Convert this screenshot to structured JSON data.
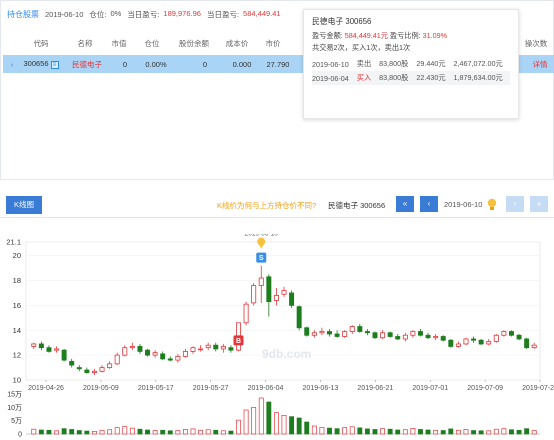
{
  "summary": {
    "title": "持仓股票",
    "date": "2019-06-10",
    "position_label": "仓位:",
    "position_value": "0%",
    "day_pl_label": "当日盈亏:",
    "day_pl_value": "189,976.96",
    "total_pl_label": "当日盈亏:",
    "total_pl_value": "584,449.41"
  },
  "table": {
    "headers": [
      "代码",
      "名称",
      "市值",
      "仓位",
      "股份余额",
      "成本价",
      "市价",
      "操次数"
    ],
    "row": {
      "code": "300656",
      "tag": "",
      "name": "民德电子",
      "market_value": "0",
      "position": "0.00%",
      "shares": "0",
      "cost": "0.000",
      "price": "27.790",
      "detail": "详情"
    }
  },
  "popup": {
    "title": "民德电子 300656",
    "pl_label": "盈亏金额:",
    "pl_value": "584,449.41元",
    "ratio_label": "盈亏比例:",
    "ratio_value": "31.09%",
    "summary": "共交易2次，买入1次，卖出1次",
    "trades": [
      {
        "date": "2019-06-10",
        "type": "卖出",
        "shares": "83,800股",
        "price": "29.440元",
        "amount": "2,467,072.00元"
      },
      {
        "date": "2019-06-04",
        "type": "买入",
        "shares": "83,800股",
        "price": "22.430元",
        "amount": "1,879,634.00元"
      }
    ]
  },
  "kline": {
    "tab_label": "K线图",
    "question": "K线价为何与上方持仓价不同?",
    "stock_label": "民德电子 300656",
    "date": "2019-06-10",
    "nav": [
      "«",
      "‹",
      "›",
      "»"
    ],
    "icon_bulb": "bulb-icon"
  },
  "chart_data": {
    "type": "candlestick",
    "y_ticks": [
      "21.1",
      "20",
      "18",
      "16",
      "14",
      "12",
      "10"
    ],
    "ylim": [
      10,
      21.1
    ],
    "x_labels": [
      "2019-04-26",
      "2019-05-09",
      "2019-05-17",
      "2019-05-27",
      "2019-06-04",
      "2019-06-13",
      "2019-06-21",
      "2019-07-01",
      "2019-07-09",
      "2019-07-23"
    ],
    "vol_ticks": [
      "15万",
      "10万",
      "5万",
      "0"
    ],
    "vol_max": 150000,
    "top_date_label": "2019-06-10",
    "markers": [
      {
        "label": "B",
        "date": "2019-06-04",
        "color": "#e3363a"
      },
      {
        "label": "S",
        "date": "2019-06-10",
        "color": "#3a8ee6"
      }
    ],
    "watermark": "9db.com",
    "colors": {
      "up": "#e3363a",
      "down": "#1e7d1e"
    },
    "candles": [
      {
        "o": 12.7,
        "c": 12.9,
        "h": 13.0,
        "l": 12.5,
        "v": 18000
      },
      {
        "o": 12.9,
        "c": 12.6,
        "h": 13.1,
        "l": 12.4,
        "v": 15000
      },
      {
        "o": 12.6,
        "c": 12.3,
        "h": 12.8,
        "l": 12.2,
        "v": 14000
      },
      {
        "o": 12.4,
        "c": 12.5,
        "h": 12.7,
        "l": 12.2,
        "v": 12000
      },
      {
        "o": 12.4,
        "c": 11.6,
        "h": 12.5,
        "l": 11.5,
        "v": 20000
      },
      {
        "o": 11.5,
        "c": 11.2,
        "h": 11.7,
        "l": 11.0,
        "v": 17000
      },
      {
        "o": 11.0,
        "c": 10.9,
        "h": 11.2,
        "l": 10.7,
        "v": 13000
      },
      {
        "o": 10.8,
        "c": 10.6,
        "h": 11.0,
        "l": 10.5,
        "v": 11000
      },
      {
        "o": 10.6,
        "c": 10.7,
        "h": 10.9,
        "l": 10.4,
        "v": 10000
      },
      {
        "o": 10.7,
        "c": 11.0,
        "h": 11.2,
        "l": 10.6,
        "v": 14000
      },
      {
        "o": 11.0,
        "c": 11.3,
        "h": 11.5,
        "l": 10.9,
        "v": 16000
      },
      {
        "o": 11.3,
        "c": 12.0,
        "h": 12.2,
        "l": 11.2,
        "v": 24000
      },
      {
        "o": 12.0,
        "c": 12.6,
        "h": 12.8,
        "l": 11.9,
        "v": 28000
      },
      {
        "o": 12.6,
        "c": 12.7,
        "h": 13.0,
        "l": 12.4,
        "v": 22000
      },
      {
        "o": 12.7,
        "c": 12.3,
        "h": 12.9,
        "l": 12.1,
        "v": 18000
      },
      {
        "o": 12.4,
        "c": 12.0,
        "h": 12.5,
        "l": 11.9,
        "v": 15000
      },
      {
        "o": 12.0,
        "c": 12.2,
        "h": 12.4,
        "l": 11.8,
        "v": 13000
      },
      {
        "o": 12.1,
        "c": 11.7,
        "h": 12.3,
        "l": 11.6,
        "v": 14000
      },
      {
        "o": 11.7,
        "c": 11.6,
        "h": 11.9,
        "l": 11.5,
        "v": 12000
      },
      {
        "o": 11.6,
        "c": 11.9,
        "h": 12.1,
        "l": 11.4,
        "v": 13000
      },
      {
        "o": 11.9,
        "c": 12.3,
        "h": 12.5,
        "l": 11.8,
        "v": 17000
      },
      {
        "o": 12.3,
        "c": 12.6,
        "h": 12.7,
        "l": 12.1,
        "v": 19000
      },
      {
        "o": 12.5,
        "c": 12.5,
        "h": 12.8,
        "l": 12.3,
        "v": 14000
      },
      {
        "o": 12.6,
        "c": 12.8,
        "h": 13.0,
        "l": 12.4,
        "v": 16000
      },
      {
        "o": 12.8,
        "c": 12.5,
        "h": 13.0,
        "l": 12.3,
        "v": 14000
      },
      {
        "o": 12.5,
        "c": 12.7,
        "h": 12.9,
        "l": 12.2,
        "v": 12000
      },
      {
        "o": 12.6,
        "c": 12.4,
        "h": 12.8,
        "l": 12.2,
        "v": 11000
      },
      {
        "o": 12.4,
        "c": 14.6,
        "h": 14.6,
        "l": 12.3,
        "v": 52000
      },
      {
        "o": 14.6,
        "c": 16.1,
        "h": 16.3,
        "l": 14.4,
        "v": 90000
      },
      {
        "o": 16.2,
        "c": 17.6,
        "h": 17.8,
        "l": 16.0,
        "v": 100000
      },
      {
        "o": 17.6,
        "c": 18.2,
        "h": 19.2,
        "l": 16.2,
        "v": 135000
      },
      {
        "o": 18.3,
        "c": 16.3,
        "h": 18.5,
        "l": 15.1,
        "v": 120000
      },
      {
        "o": 16.4,
        "c": 16.8,
        "h": 17.4,
        "l": 16.0,
        "v": 80000
      },
      {
        "o": 16.9,
        "c": 17.2,
        "h": 17.5,
        "l": 16.7,
        "v": 70000
      },
      {
        "o": 17.0,
        "c": 16.0,
        "h": 17.2,
        "l": 15.8,
        "v": 65000
      },
      {
        "o": 15.9,
        "c": 14.2,
        "h": 16.0,
        "l": 14.0,
        "v": 60000
      },
      {
        "o": 14.2,
        "c": 13.6,
        "h": 14.3,
        "l": 13.5,
        "v": 45000
      },
      {
        "o": 13.6,
        "c": 13.8,
        "h": 14.0,
        "l": 13.4,
        "v": 30000
      },
      {
        "o": 13.8,
        "c": 13.9,
        "h": 14.2,
        "l": 13.6,
        "v": 25000
      },
      {
        "o": 13.9,
        "c": 13.7,
        "h": 14.1,
        "l": 13.5,
        "v": 22000
      },
      {
        "o": 13.7,
        "c": 13.5,
        "h": 14.0,
        "l": 13.4,
        "v": 20000
      },
      {
        "o": 13.5,
        "c": 13.9,
        "h": 14.0,
        "l": 13.4,
        "v": 24000
      },
      {
        "o": 13.9,
        "c": 14.3,
        "h": 14.4,
        "l": 13.7,
        "v": 27000
      },
      {
        "o": 14.3,
        "c": 13.9,
        "h": 14.5,
        "l": 13.8,
        "v": 23000
      },
      {
        "o": 13.9,
        "c": 13.8,
        "h": 14.1,
        "l": 13.6,
        "v": 19000
      },
      {
        "o": 13.8,
        "c": 13.4,
        "h": 13.9,
        "l": 13.3,
        "v": 17000
      },
      {
        "o": 13.4,
        "c": 13.8,
        "h": 14.0,
        "l": 13.3,
        "v": 20000
      },
      {
        "o": 13.8,
        "c": 13.5,
        "h": 13.9,
        "l": 13.4,
        "v": 18000
      },
      {
        "o": 13.5,
        "c": 13.3,
        "h": 13.7,
        "l": 13.2,
        "v": 15000
      },
      {
        "o": 13.3,
        "c": 13.6,
        "h": 13.8,
        "l": 13.1,
        "v": 16000
      },
      {
        "o": 13.6,
        "c": 13.9,
        "h": 14.0,
        "l": 13.4,
        "v": 21000
      },
      {
        "o": 13.9,
        "c": 13.6,
        "h": 14.1,
        "l": 13.5,
        "v": 17000
      },
      {
        "o": 13.6,
        "c": 13.4,
        "h": 13.8,
        "l": 13.3,
        "v": 15000
      },
      {
        "o": 13.4,
        "c": 13.5,
        "h": 13.7,
        "l": 13.2,
        "v": 14000
      },
      {
        "o": 13.5,
        "c": 13.2,
        "h": 13.6,
        "l": 13.1,
        "v": 13000
      },
      {
        "o": 13.2,
        "c": 12.7,
        "h": 13.3,
        "l": 12.6,
        "v": 19000
      },
      {
        "o": 12.7,
        "c": 12.9,
        "h": 13.1,
        "l": 12.6,
        "v": 14000
      },
      {
        "o": 12.9,
        "c": 13.3,
        "h": 13.4,
        "l": 12.8,
        "v": 17000
      },
      {
        "o": 13.3,
        "c": 13.2,
        "h": 13.5,
        "l": 13.0,
        "v": 13000
      },
      {
        "o": 13.2,
        "c": 12.9,
        "h": 13.3,
        "l": 12.8,
        "v": 12000
      },
      {
        "o": 12.9,
        "c": 13.1,
        "h": 13.3,
        "l": 12.8,
        "v": 12000
      },
      {
        "o": 13.1,
        "c": 13.6,
        "h": 13.7,
        "l": 13.0,
        "v": 18000
      },
      {
        "o": 13.6,
        "c": 13.9,
        "h": 14.0,
        "l": 13.5,
        "v": 20000
      },
      {
        "o": 13.9,
        "c": 13.6,
        "h": 14.0,
        "l": 13.5,
        "v": 16000
      },
      {
        "o": 13.6,
        "c": 13.3,
        "h": 13.7,
        "l": 13.2,
        "v": 14000
      },
      {
        "o": 13.3,
        "c": 12.6,
        "h": 13.4,
        "l": 12.5,
        "v": 20000
      },
      {
        "o": 12.6,
        "c": 12.8,
        "h": 13.0,
        "l": 12.5,
        "v": 13000
      }
    ]
  }
}
